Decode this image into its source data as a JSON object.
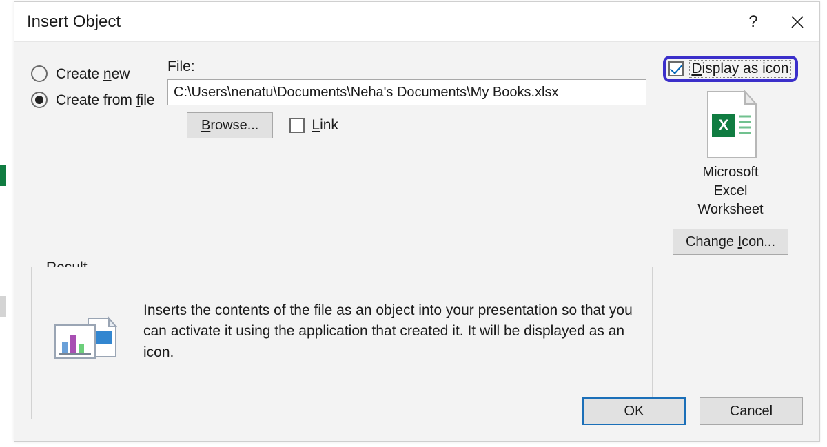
{
  "dialog": {
    "title": "Insert Object",
    "help_tooltip": "?",
    "close_tooltip": "Close"
  },
  "radios": {
    "create_new": "Create new",
    "create_new_checked": false,
    "create_from_file": "Create from file",
    "create_from_file_checked": true
  },
  "file": {
    "label": "File:",
    "value": "C:\\Users\\nenatu\\Documents\\Neha's Documents\\My Books.xlsx",
    "browse": "Browse...",
    "link_label": "Link",
    "link_checked": false
  },
  "display_as_icon": {
    "label": "Display as icon",
    "checked": true,
    "icon_caption_line1": "Microsoft",
    "icon_caption_line2": "Excel",
    "icon_caption_line3": "Worksheet",
    "change_icon_button": "Change Icon..."
  },
  "result": {
    "legend": "Result",
    "text": "Inserts the contents of the file as an object into your presentation so that you can activate it using the application that created it. It will be displayed as an icon."
  },
  "buttons": {
    "ok": "OK",
    "cancel": "Cancel"
  }
}
